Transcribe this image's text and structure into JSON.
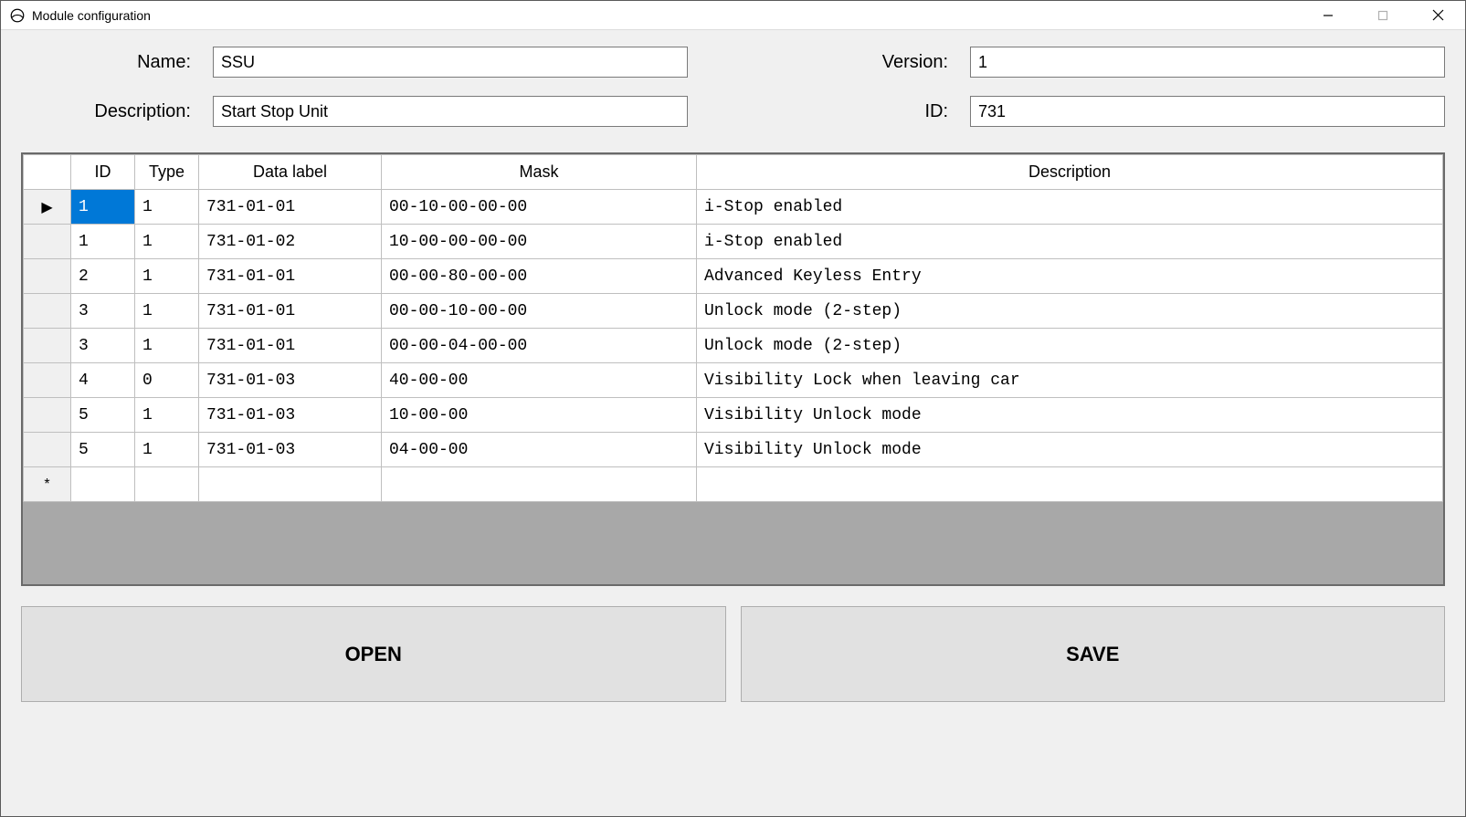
{
  "window": {
    "title": "Module configuration"
  },
  "form": {
    "name_label": "Name:",
    "name_value": "SSU",
    "description_label": "Description:",
    "description_value": "Start Stop Unit",
    "version_label": "Version:",
    "version_value": "1",
    "id_label": "ID:",
    "id_value": "731"
  },
  "grid": {
    "headers": {
      "id": "ID",
      "type": "Type",
      "data_label": "Data label",
      "mask": "Mask",
      "description": "Description"
    },
    "rows": [
      {
        "marker": "▶",
        "id": "1",
        "type": "1",
        "label": "731-01-01",
        "mask": "00-10-00-00-00",
        "desc": "i-Stop enabled",
        "selected": true
      },
      {
        "marker": "",
        "id": "1",
        "type": "1",
        "label": "731-01-02",
        "mask": "10-00-00-00-00",
        "desc": "i-Stop enabled"
      },
      {
        "marker": "",
        "id": "2",
        "type": "1",
        "label": "731-01-01",
        "mask": "00-00-80-00-00",
        "desc": "Advanced Keyless Entry"
      },
      {
        "marker": "",
        "id": "3",
        "type": "1",
        "label": "731-01-01",
        "mask": "00-00-10-00-00",
        "desc": "Unlock mode (2-step)"
      },
      {
        "marker": "",
        "id": "3",
        "type": "1",
        "label": "731-01-01",
        "mask": "00-00-04-00-00",
        "desc": "Unlock mode (2-step)"
      },
      {
        "marker": "",
        "id": "4",
        "type": "0",
        "label": "731-01-03",
        "mask": "40-00-00",
        "desc": "Visibility Lock when leaving car"
      },
      {
        "marker": "",
        "id": "5",
        "type": "1",
        "label": "731-01-03",
        "mask": "10-00-00",
        "desc": "Visibility Unlock mode"
      },
      {
        "marker": "",
        "id": "5",
        "type": "1",
        "label": "731-01-03",
        "mask": "04-00-00",
        "desc": "Visibility Unlock mode"
      }
    ],
    "new_row_marker": "*"
  },
  "buttons": {
    "open": "OPEN",
    "save": "SAVE"
  }
}
